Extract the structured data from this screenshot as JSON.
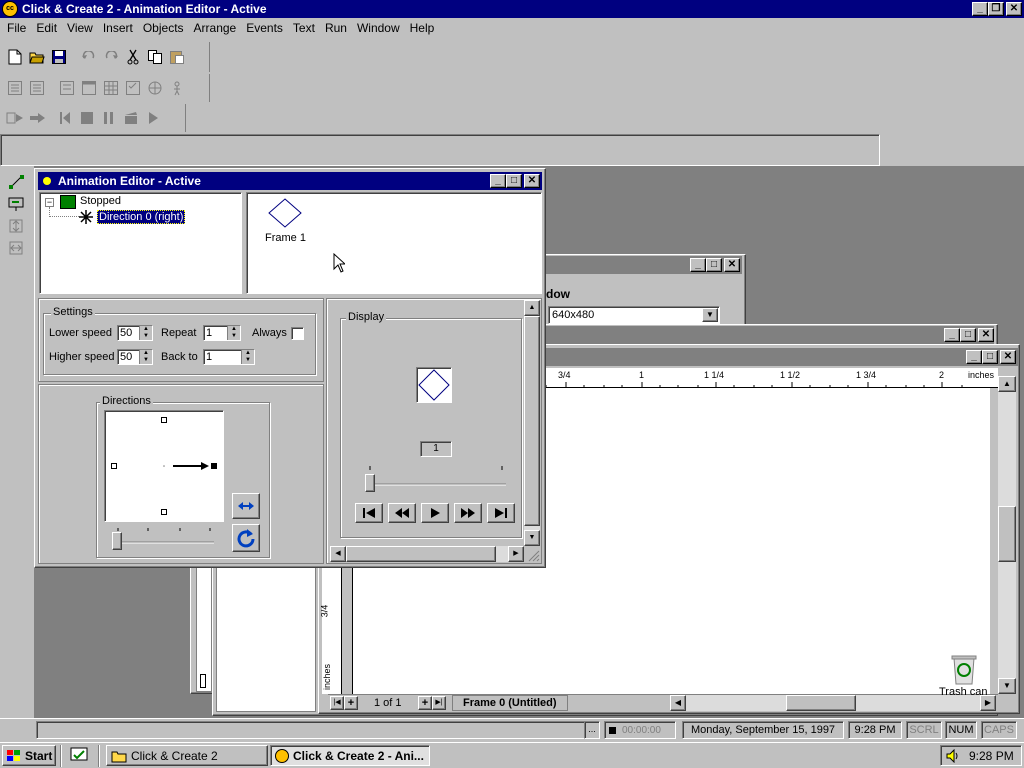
{
  "app": {
    "title": "Click & Create 2 - Animation Editor - Active"
  },
  "menu": [
    "File",
    "Edit",
    "View",
    "Insert",
    "Objects",
    "Arrange",
    "Events",
    "Text",
    "Run",
    "Window",
    "Help"
  ],
  "anim": {
    "title": "Animation Editor - Active",
    "tree_root": "Stopped",
    "tree_child": "Direction 0 (right)",
    "frame_label": "Frame 1",
    "settings_legend": "Settings",
    "lower_speed_label": "Lower speed",
    "lower_speed": "50",
    "higher_speed_label": "Higher speed",
    "higher_speed": "50",
    "repeat_label": "Repeat",
    "repeat": "1",
    "always_label": "Always",
    "backto_label": "Back to",
    "backto": "1",
    "directions_legend": "Directions",
    "display_legend": "Display",
    "frame_counter": "1"
  },
  "bgwin": {
    "title_partial": "dow",
    "resolution": "640x480"
  },
  "frame_editor": {
    "ruler_labels": [
      "3/4",
      "1",
      "1 1/4",
      "1 1/2",
      "1 3/4",
      "2",
      "inches"
    ],
    "vruler_labels": [
      "3/4",
      "inches"
    ],
    "page_indicator": "1 of 1",
    "frame_tab": "Frame 0 (Untitled)"
  },
  "desktop": {
    "trash": "Trash can"
  },
  "status": {
    "timer": "00:00:00",
    "date": "Monday, September 15, 1997",
    "time": "9:28 PM",
    "scrl": "SCRL",
    "num": "NUM",
    "caps": "CAPS"
  },
  "taskbar": {
    "start": "Start",
    "task1": "Click & Create 2",
    "task2": "Click & Create 2 - Ani...",
    "clock": "9:28 PM"
  },
  "colors": {
    "title_active": "#000080",
    "face": "#c0c0c0",
    "desktop": "#808080"
  }
}
